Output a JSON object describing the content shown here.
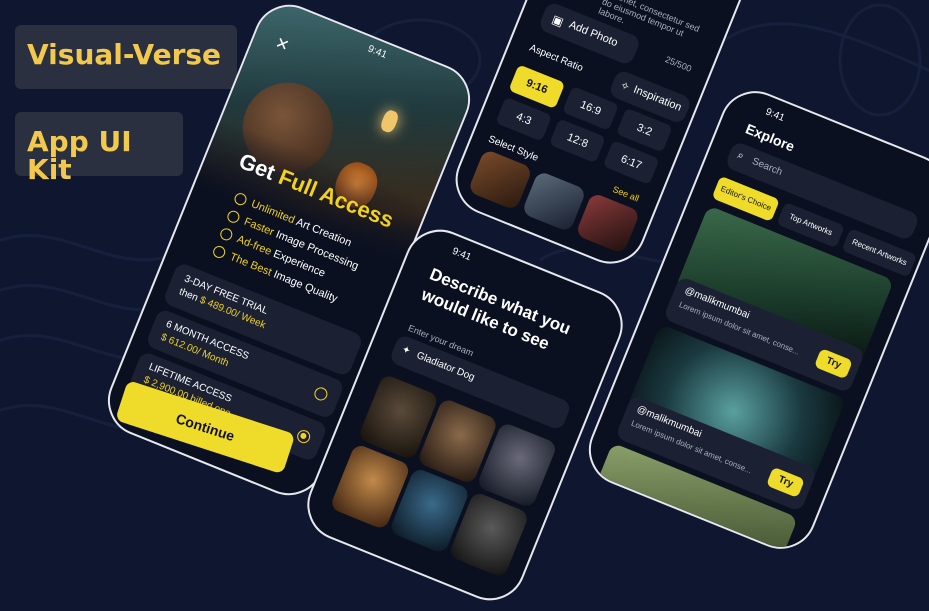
{
  "badges": {
    "title": "Visual-Verse",
    "subtitle": "App UI Kit"
  },
  "phone1": {
    "time": "9:41",
    "heading_prefix": "Get",
    "heading_highlight": "Full Access",
    "features": [
      {
        "hl": "Unlimited",
        "rest": "Art Creation"
      },
      {
        "hl": "Faster",
        "rest": "Image Processing"
      },
      {
        "hl": "Ad-free",
        "rest": "Experience"
      },
      {
        "hl": "The Best",
        "rest": "Image Quality"
      }
    ],
    "plans": [
      {
        "name": "3-DAY FREE TRIAL",
        "price_prefix": "then",
        "price": "$ 489.00/ Week",
        "selected": false
      },
      {
        "name": "6 MONTH ACCESS",
        "price_prefix": "",
        "price": "$ 612.00/ Month",
        "selected": false
      },
      {
        "name": "LIFETIME ACCESS",
        "price_prefix": "",
        "price": "$ 2,900.00 billed one",
        "selected": true
      }
    ],
    "continue_label": "Continue"
  },
  "phone2": {
    "lorem": "sit amet, consectetur sed do eiusmod tempor ut labore.",
    "add_photo": "Add Photo",
    "counter": "25/500",
    "aspect_label": "Aspect Ratio",
    "inspiration": "Inspiration",
    "ratios": [
      "9:16",
      "16:9",
      "3:2",
      "4:3",
      "12:8",
      "6:17"
    ],
    "select_style": "Select Style",
    "see_all": "See all"
  },
  "phone3": {
    "time": "9:41",
    "heading": "Describe what you would like to see",
    "input_label": "Enter your dream",
    "input_value": "Gladiator Dog"
  },
  "phone4": {
    "time": "9:41",
    "title": "Explore",
    "search_placeholder": "Search",
    "tabs": [
      "Editor's Choice",
      "Top Artworks",
      "Recent Artworks"
    ],
    "posts": [
      {
        "user": "@malikmumbai",
        "desc": "Lorem ipsum dolor sit amet, conse...",
        "try": "Try"
      },
      {
        "user": "@malikmumbai",
        "desc": "Lorem ipsum dolor sit amet, conse...",
        "try": "Try"
      }
    ]
  },
  "colors": {
    "background": "#0f1730",
    "accent": "#f2d21e",
    "card": "#1b2133"
  }
}
